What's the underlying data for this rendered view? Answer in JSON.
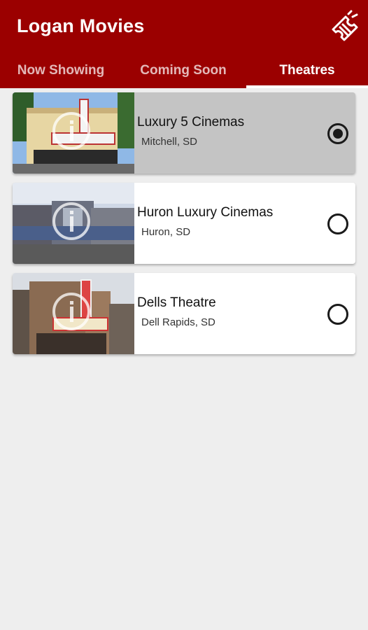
{
  "app": {
    "title": "Logan Movies",
    "action_icon": "ticket-icon"
  },
  "colors": {
    "primary": "#9b0000",
    "selected_card": "#c4c4c4",
    "background": "#eeeeee"
  },
  "tabs": [
    {
      "label": "Now Showing",
      "active": false
    },
    {
      "label": "Coming Soon",
      "active": false
    },
    {
      "label": "Theatres",
      "active": true
    }
  ],
  "theatres": [
    {
      "name": "Luxury 5 Cinemas",
      "location": "Mitchell, SD",
      "selected": true
    },
    {
      "name": "Huron Luxury Cinemas",
      "location": "Huron, SD",
      "selected": false
    },
    {
      "name": "Dells Theatre",
      "location": "Dell Rapids, SD",
      "selected": false
    }
  ]
}
